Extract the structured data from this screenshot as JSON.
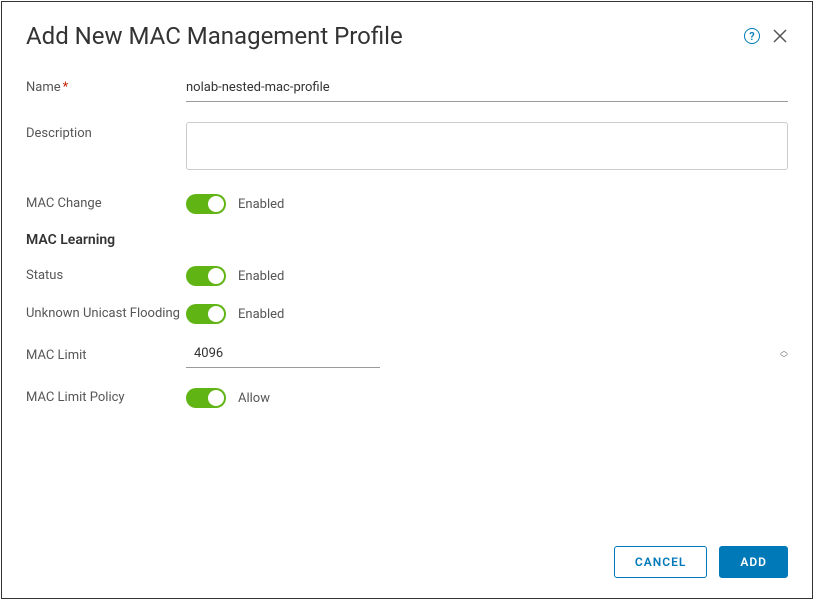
{
  "header": {
    "title": "Add New MAC Management Profile"
  },
  "form": {
    "name_label": "Name",
    "name_required": "*",
    "name_value": "nolab-nested-mac-profile",
    "description_label": "Description",
    "description_value": "",
    "mac_change_label": "MAC Change",
    "mac_change_status": "Enabled",
    "section_heading": "MAC Learning",
    "status_label": "Status",
    "status_value": "Enabled",
    "unknown_unicast_label": "Unknown Unicast Flooding",
    "unknown_unicast_value": "Enabled",
    "mac_limit_label": "MAC Limit",
    "mac_limit_value": "4096",
    "mac_limit_policy_label": "MAC Limit Policy",
    "mac_limit_policy_value": "Allow"
  },
  "footer": {
    "cancel_label": "CANCEL",
    "add_label": "ADD"
  }
}
